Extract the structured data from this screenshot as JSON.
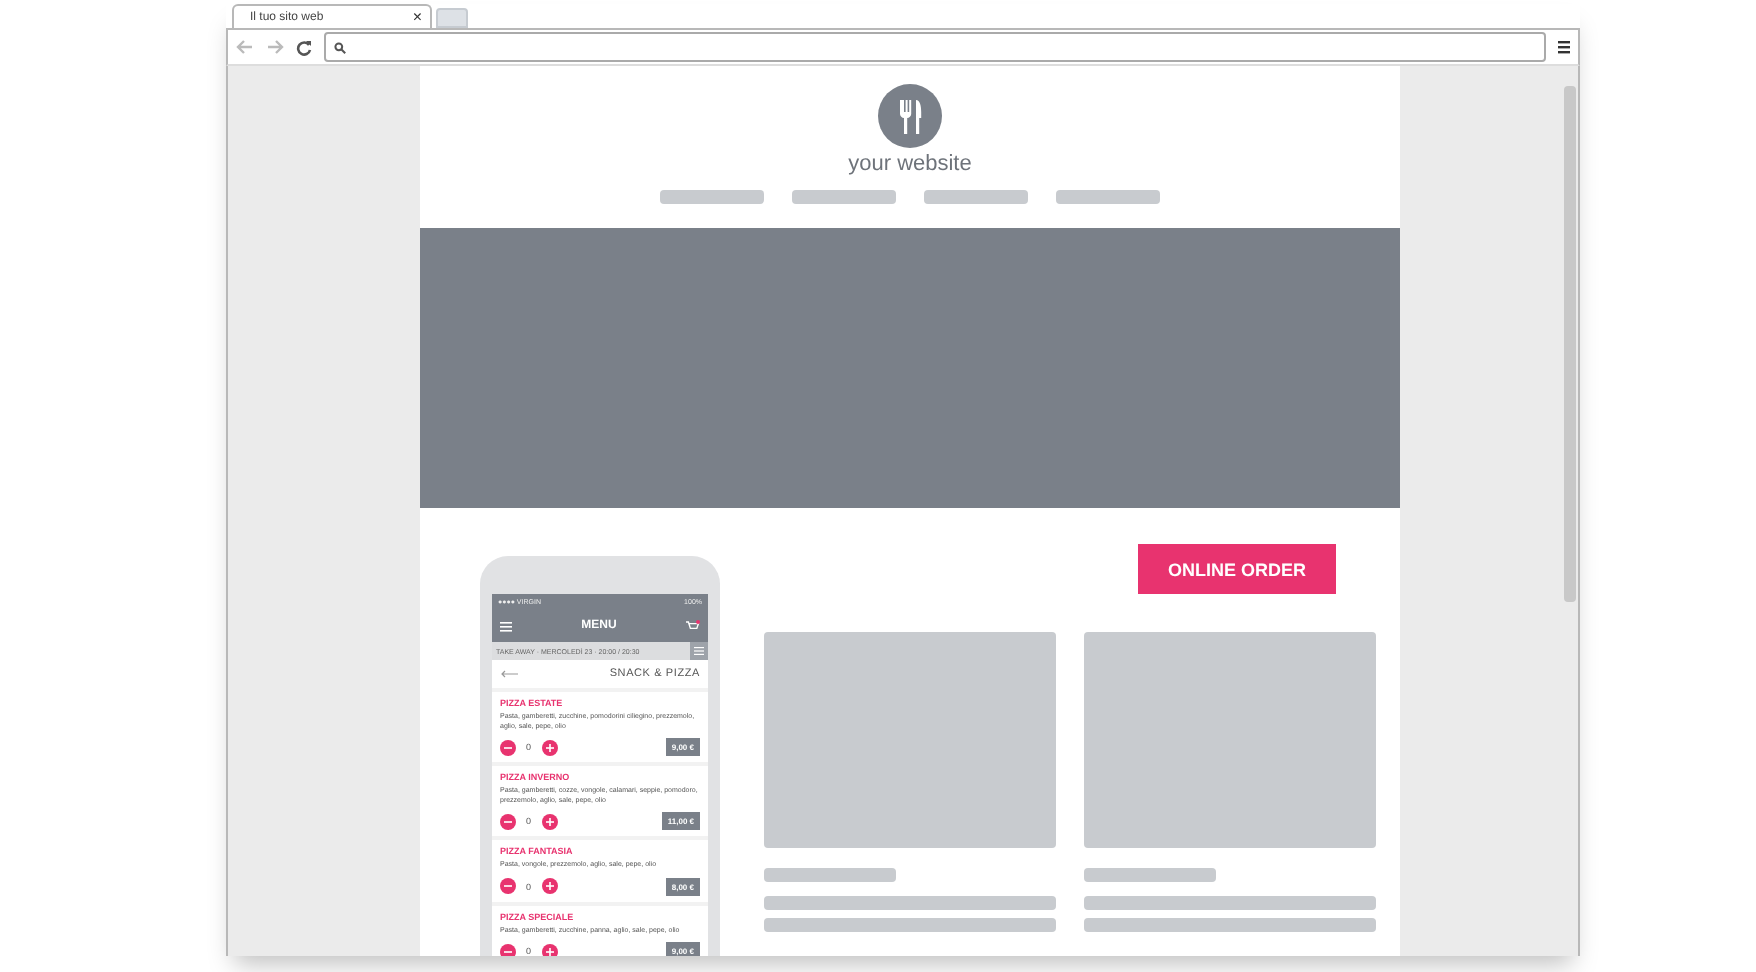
{
  "browser": {
    "tab_title": "Il tuo sito web",
    "tab_close": "×"
  },
  "site": {
    "brand": "your website",
    "cta": "ONLINE ORDER"
  },
  "phone": {
    "carrier": "●●●● VIRGIN",
    "battery": "100%",
    "title": "MENU",
    "subbar": "TAKE AWAY · MERCOLEDÌ 23 · 20:00 / 20:30",
    "category": "SNACK & PIZZA",
    "items": [
      {
        "name": "PIZZA ESTATE",
        "description": "Pasta, gamberetti, zucchine, pomodorini ciliegino, prezzemolo, aglio, sale, pepe, olio",
        "quantity": "0",
        "price": "9,00 €"
      },
      {
        "name": "PIZZA INVERNO",
        "description": "Pasta, gamberetti, cozze, vongole, calamari, seppie, pomodoro, prezzemolo, aglio, sale, pepe, olio",
        "quantity": "0",
        "price": "11,00 €"
      },
      {
        "name": "PIZZA FANTASIA",
        "description": "Pasta, vongole, prezzemolo, aglio, sale, pepe, olio",
        "quantity": "0",
        "price": "8,00 €"
      },
      {
        "name": "PIZZA SPECIALE",
        "description": "Pasta, gamberetti, zucchine, panna, aglio, sale, pepe, olio",
        "quantity": "0",
        "price": "9,00 €"
      }
    ]
  }
}
